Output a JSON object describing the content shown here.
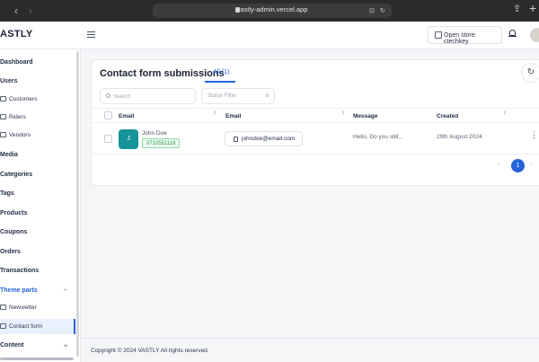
{
  "browser": {
    "url": "vastly-admin.vercel.app",
    "back": "‹",
    "forward": "›",
    "translate_icon": "⊡",
    "reload_icon": "↻",
    "share_icon": "⇪",
    "new_tab_icon": "+"
  },
  "header": {
    "brand": "ASTLY",
    "open_store_label": "Open store: ctechkey"
  },
  "sidebar": {
    "dashboard": "Dashboard",
    "users": "Users",
    "customers": "Customers",
    "riders": "Riders",
    "vendors": "Vendors",
    "media": "Media",
    "categories": "Categories",
    "tags": "Tags",
    "products": "Products",
    "coupons": "Coupons",
    "orders": "Orders",
    "transactions": "Transactions",
    "theme_parts": "Theme parts",
    "newsletter": "Newsletter",
    "contact_form": "Contact form",
    "content": "Content",
    "chevron_up": "^",
    "chevron_down": "v"
  },
  "main": {
    "title": "Contact form submissions",
    "tab_all": "All (1)",
    "refresh_icon": "↻",
    "search_placeholder": "Search",
    "status_filter_placeholder": "Status Filter",
    "status_filter_clear": "⊗",
    "columns": [
      "Email",
      "Email",
      "Message",
      "Created"
    ],
    "sort_glyph": "⇕",
    "rows": [
      {
        "avatar_letter": "J",
        "name": "John Doe",
        "phone": "0710551118",
        "email": "johndoe@email.com",
        "message": "Hello, Do you still...",
        "created": "29th August 2024",
        "actions_icon": "⋮"
      }
    ],
    "pagination": {
      "prev": "‹",
      "current": "1",
      "next": "›"
    }
  },
  "footer": {
    "copyright": "Copyright © 2024 VASTLY All rights reserved."
  },
  "colors": {
    "accent": "#2563d8",
    "avatar_bg": "#14939a",
    "phone_badge": "#1f9d55"
  }
}
